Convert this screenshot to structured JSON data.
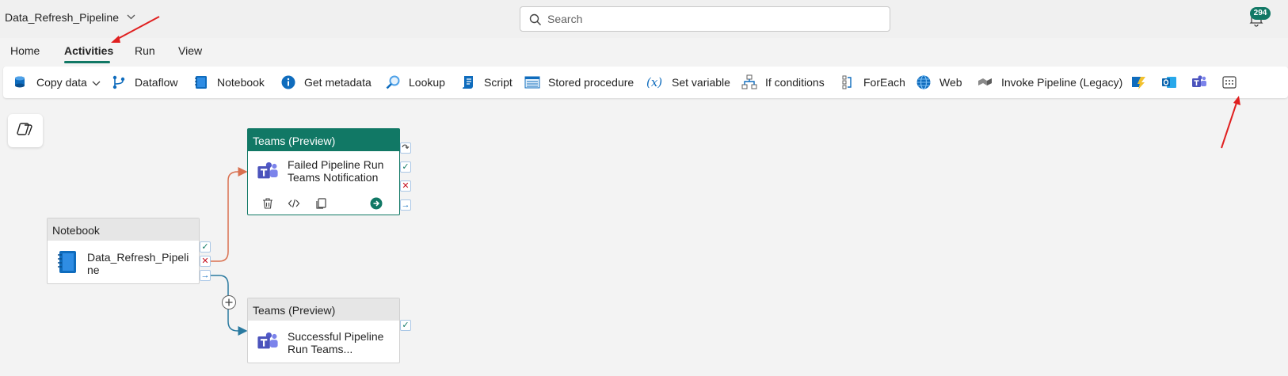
{
  "header": {
    "pipeline_name": "Data_Refresh_Pipeline",
    "search_placeholder": "Search",
    "notification_count": "294"
  },
  "tabs": [
    {
      "label": "Home"
    },
    {
      "label": "Activities",
      "active": true
    },
    {
      "label": "Run"
    },
    {
      "label": "View"
    }
  ],
  "toolbar": {
    "items": [
      {
        "label": "Copy data",
        "icon": "copy-data-icon"
      },
      {
        "label": "Dataflow",
        "icon": "dataflow-icon"
      },
      {
        "label": "Notebook",
        "icon": "notebook-icon"
      },
      {
        "label": "Get metadata",
        "icon": "info-icon"
      },
      {
        "label": "Lookup",
        "icon": "lookup-icon"
      },
      {
        "label": "Script",
        "icon": "script-icon"
      },
      {
        "label": "Stored procedure",
        "icon": "stored-procedure-icon"
      },
      {
        "label": "Set variable",
        "icon": "variable-icon"
      },
      {
        "label": "If conditions",
        "icon": "if-conditions-icon"
      },
      {
        "label": "ForEach",
        "icon": "foreach-icon"
      },
      {
        "label": "Web",
        "icon": "web-icon"
      },
      {
        "label": "Invoke Pipeline (Legacy)",
        "icon": "invoke-pipeline-icon"
      }
    ],
    "icon_only": [
      "azure-function-icon",
      "outlook-icon",
      "teams-icon",
      "more-activities-icon"
    ]
  },
  "canvas": {
    "nodes": {
      "notebook": {
        "type_label": "Notebook",
        "name_line1": "Data_Refresh_Pipeli",
        "name_line2": "ne"
      },
      "teams_failed": {
        "type_label": "Teams (Preview)",
        "name_line1": "Failed Pipeline Run",
        "name_line2": "Teams Notification"
      },
      "teams_success": {
        "type_label": "Teams (Preview)",
        "name_line1": "Successful Pipeline",
        "name_line2": "Run Teams..."
      }
    }
  },
  "colors": {
    "accent": "#117865",
    "fail_wire": "#d9704f",
    "success_wire": "#2a7aa0",
    "annotation_arrow": "#e02020"
  }
}
